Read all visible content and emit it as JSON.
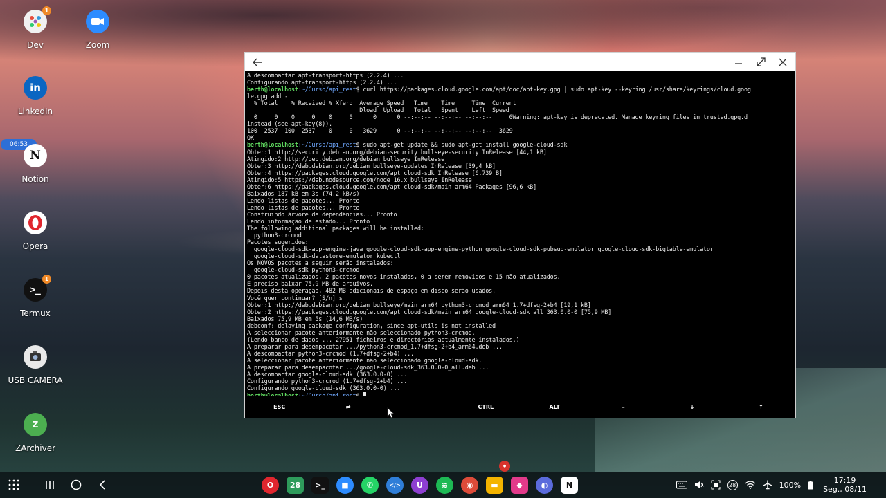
{
  "desktop": {
    "icons": [
      {
        "label": "Dev",
        "icon": "dev-folder-icon",
        "badge": "1"
      },
      {
        "label": "Zoom",
        "icon": "zoom-icon"
      },
      {
        "label": "LinkedIn",
        "icon": "linkedin-icon"
      },
      {
        "label": "Notion",
        "icon": "notion-icon"
      },
      {
        "label": "Opera",
        "icon": "opera-icon"
      },
      {
        "label": "Termux",
        "icon": "termux-icon",
        "badge": "1"
      },
      {
        "label": "USB CAMERA",
        "icon": "usb-camera-icon"
      },
      {
        "label": "ZArchiver",
        "icon": "zarchiver-icon"
      }
    ],
    "time_pill": "06:53"
  },
  "terminal": {
    "lines": [
      {
        "t": "A descompactar apt-transport-https (2.2.4) ..."
      },
      {
        "t": "Configurando apt-transport-https (2.2.4) ..."
      },
      {
        "user": "berth@localhost",
        "path": ":~/Curso/api_rest",
        "cmd": "$ curl https://packages.cloud.google.com/apt/doc/apt-key.gpg | sudo apt-key --keyring /usr/share/keyrings/cloud.goog"
      },
      {
        "t": "le.gpg add -"
      },
      {
        "t": "  % Total    % Received % Xferd  Average Speed   Time    Time     Time  Current"
      },
      {
        "t": "                                 Dload  Upload   Total   Spent    Left  Speed"
      },
      {
        "t": "  0     0    0     0    0     0      0      0 --:--:-- --:--:-- --:--:--     0Warning: apt-key is deprecated. Manage keyring files in trusted.gpg.d"
      },
      {
        "t": "instead (see apt-key(8))."
      },
      {
        "t": "100  2537  100  2537    0     0   3629      0 --:--:-- --:--:-- --:--:--  3629"
      },
      {
        "t": "OK"
      },
      {
        "user": "berth@localhost",
        "path": ":~/Curso/api_rest",
        "cmd": "$ sudo apt-get update && sudo apt-get install google-cloud-sdk"
      },
      {
        "t": "Obter:1 http://security.debian.org/debian-security bullseye-security InRelease [44,1 kB]"
      },
      {
        "t": "Atingido:2 http://deb.debian.org/debian bullseye InRelease"
      },
      {
        "t": "Obter:3 http://deb.debian.org/debian bullseye-updates InRelease [39,4 kB]"
      },
      {
        "t": "Obter:4 https://packages.cloud.google.com/apt cloud-sdk InRelease [6.739 B]"
      },
      {
        "t": "Atingido:5 https://deb.nodesource.com/node_16.x bullseye InRelease"
      },
      {
        "t": "Obter:6 https://packages.cloud.google.com/apt cloud-sdk/main arm64 Packages [96,6 kB]"
      },
      {
        "t": "Baixados 187 kB em 3s (74,2 kB/s)"
      },
      {
        "t": "Lendo listas de pacotes... Pronto"
      },
      {
        "t": "Lendo listas de pacotes... Pronto"
      },
      {
        "t": "Construindo árvore de dependências... Pronto"
      },
      {
        "t": "Lendo informação de estado... Pronto"
      },
      {
        "t": "The following additional packages will be installed:"
      },
      {
        "t": "  python3-crcmod"
      },
      {
        "t": "Pacotes sugeridos:"
      },
      {
        "t": "  google-cloud-sdk-app-engine-java google-cloud-sdk-app-engine-python google-cloud-sdk-pubsub-emulator google-cloud-sdk-bigtable-emulator"
      },
      {
        "t": "  google-cloud-sdk-datastore-emulator kubectl"
      },
      {
        "t": "Os NOVOS pacotes a seguir serão instalados:"
      },
      {
        "t": "  google-cloud-sdk python3-crcmod"
      },
      {
        "t": "0 pacotes atualizados, 2 pacotes novos instalados, 0 a serem removidos e 15 não atualizados."
      },
      {
        "t": "É preciso baixar 75,9 MB de arquivos."
      },
      {
        "t": "Depois desta operação, 482 MB adicionais de espaço em disco serão usados."
      },
      {
        "t": "Você quer continuar? [S/n] s"
      },
      {
        "t": "Obter:1 http://deb.debian.org/debian bullseye/main arm64 python3-crcmod arm64 1.7+dfsg-2+b4 [19,1 kB]"
      },
      {
        "t": "Obter:2 https://packages.cloud.google.com/apt cloud-sdk/main arm64 google-cloud-sdk all 363.0.0-0 [75,9 MB]"
      },
      {
        "t": "Baixados 75,9 MB em 5s (14,6 MB/s)"
      },
      {
        "t": "debconf: delaying package configuration, since apt-utils is not installed"
      },
      {
        "t": "A seleccionar pacote anteriormente não seleccionado python3-crcmod."
      },
      {
        "t": "(Lendo banco de dados ... 27951 ficheiros e directórios actualmente instalados.)"
      },
      {
        "t": "A preparar para desempacotar .../python3-crcmod_1.7+dfsg-2+b4_arm64.deb ..."
      },
      {
        "t": "A descompactar python3-crcmod (1.7+dfsg-2+b4) ..."
      },
      {
        "t": "A seleccionar pacote anteriormente não seleccionado google-cloud-sdk."
      },
      {
        "t": "A preparar para desempacotar .../google-cloud-sdk_363.0.0-0_all.deb ..."
      },
      {
        "t": "A descompactar google-cloud-sdk (363.0.0-0) ..."
      },
      {
        "t": "Configurando python3-crcmod (1.7+dfsg-2+b4) ..."
      },
      {
        "t": "Configurando google-cloud-sdk (363.0.0-0) ..."
      },
      {
        "user": "berth@localhost",
        "path": ":~/Curso/api_rest",
        "cmd": "$ ",
        "cursor": true
      }
    ],
    "extra_keys": [
      "ESC",
      "⇄",
      "",
      "CTRL",
      "ALT",
      "–",
      "↓",
      "↑"
    ]
  },
  "taskbar": {
    "apps": [
      {
        "icon": "opera-icon",
        "glyph": "O",
        "color": "#e0262e"
      },
      {
        "icon": "calendar-icon",
        "glyph": "28",
        "color": "#2e9b5b",
        "square": true
      },
      {
        "icon": "termux-icon",
        "glyph": ">_",
        "color": "#111111",
        "square": true
      },
      {
        "icon": "zoom-icon",
        "glyph": "■",
        "color": "#2d8cff"
      },
      {
        "icon": "whatsapp-icon",
        "glyph": "✆",
        "color": "#25d366"
      },
      {
        "icon": "code-editor-icon",
        "glyph": "</>",
        "color": "#2f7ed8"
      },
      {
        "icon": "u-app-icon",
        "glyph": "U",
        "color": "#8e3fd1"
      },
      {
        "icon": "spotify-icon",
        "glyph": "≋",
        "color": "#1db954"
      },
      {
        "icon": "chrome-icon",
        "glyph": "◉",
        "color": "#dd4b39"
      },
      {
        "icon": "files-icon",
        "glyph": "▬",
        "color": "#f4b400",
        "square": true
      },
      {
        "icon": "store-icon",
        "glyph": "◆",
        "color": "#e23a8a",
        "square": true
      },
      {
        "icon": "internet-icon",
        "glyph": "◐",
        "color": "#5b6bdc"
      },
      {
        "icon": "notion-icon",
        "glyph": "N",
        "color": "#ffffff",
        "square": true
      }
    ],
    "tray": {
      "notification_count": "28",
      "battery": "100%",
      "time": "17:19",
      "date": "Seg., 08/11"
    }
  }
}
